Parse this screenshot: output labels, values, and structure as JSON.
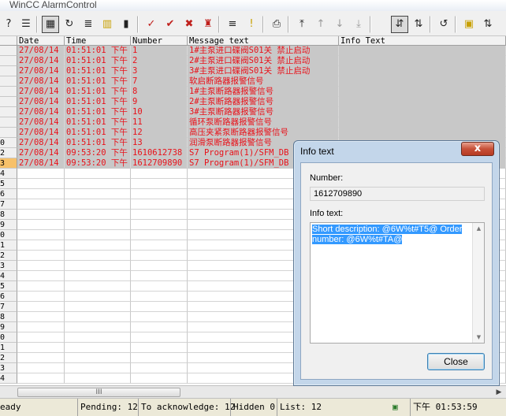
{
  "window": {
    "title": "WinCC AlarmControl"
  },
  "toolbar": {
    "buttons": [
      {
        "icon": "help-icon",
        "glyph": "?"
      },
      {
        "icon": "message-list-icon",
        "glyph": "☰"
      },
      {
        "icon": "table-view-icon",
        "glyph": "▦"
      },
      {
        "icon": "refresh-icon",
        "glyph": "↻"
      },
      {
        "icon": "hit-list-icon",
        "glyph": "≣"
      },
      {
        "icon": "archive-icon",
        "glyph": "▥"
      },
      {
        "icon": "statistics-icon",
        "glyph": "▮"
      },
      {
        "icon": "acknowledge-icon",
        "glyph": "✓"
      },
      {
        "icon": "group-acknowledge-icon",
        "glyph": "✔"
      },
      {
        "icon": "emergency-acknowledge-icon",
        "glyph": "✖"
      },
      {
        "icon": "horn-icon",
        "glyph": "♜"
      },
      {
        "icon": "selection-icon",
        "glyph": "≡"
      },
      {
        "icon": "info-text-icon",
        "glyph": "!"
      },
      {
        "icon": "print-icon",
        "glyph": "⎙"
      },
      {
        "icon": "first-icon",
        "glyph": "⤒"
      },
      {
        "icon": "previous-icon",
        "glyph": "↑"
      },
      {
        "icon": "next-icon",
        "glyph": "↓"
      },
      {
        "icon": "last-icon",
        "glyph": "⤓"
      },
      {
        "icon": "autoscroll-icon",
        "glyph": "⇵"
      },
      {
        "icon": "lock-icon",
        "glyph": "🔒"
      },
      {
        "icon": "sort-icon",
        "glyph": "⇅"
      }
    ]
  },
  "table": {
    "columns": [
      "Date",
      "Time",
      "Number",
      "Message text",
      "Info Text"
    ],
    "row_numbers": [
      "",
      "",
      "",
      "",
      "",
      "",
      "",
      "",
      "",
      "",
      "",
      "",
      "",
      "",
      "",
      "",
      "",
      "",
      "",
      "",
      "",
      "",
      "",
      "",
      "",
      "",
      "",
      "",
      "",
      "",
      "",
      "",
      "",
      ""
    ],
    "visible_row_numbers": [
      "1",
      "2",
      "3",
      "4",
      "5",
      "6",
      "7",
      "8",
      "9",
      "0",
      "1",
      "2",
      "3",
      "4",
      "5",
      "6",
      "7",
      "8",
      "9",
      "0",
      "1",
      "2",
      "3",
      "4",
      "5",
      "6",
      "7",
      "8",
      "9",
      "0",
      "1",
      "2",
      "3"
    ],
    "rows": [
      {
        "date": "27/08/14",
        "time": "01:51:01 下午",
        "number": "1",
        "message": "1#主泵进口碟阀S01关 禁止启动",
        "info": ""
      },
      {
        "date": "27/08/14",
        "time": "01:51:01 下午",
        "number": "2",
        "message": "2#主泵进口碟阀S01关 禁止启动",
        "info": ""
      },
      {
        "date": "27/08/14",
        "time": "01:51:01 下午",
        "number": "3",
        "message": "3#主泵进口碟阀S01关 禁止启动",
        "info": ""
      },
      {
        "date": "27/08/14",
        "time": "01:51:01 下午",
        "number": "7",
        "message": "软启断路器报警信号",
        "info": ""
      },
      {
        "date": "27/08/14",
        "time": "01:51:01 下午",
        "number": "8",
        "message": "1#主泵断路器报警信号",
        "info": ""
      },
      {
        "date": "27/08/14",
        "time": "01:51:01 下午",
        "number": "9",
        "message": "2#主泵断路器报警信号",
        "info": ""
      },
      {
        "date": "27/08/14",
        "time": "01:51:01 下午",
        "number": "10",
        "message": "3#主泵断路器报警信号",
        "info": ""
      },
      {
        "date": "27/08/14",
        "time": "01:51:01 下午",
        "number": "11",
        "message": "循环泵断路器报警信号",
        "info": ""
      },
      {
        "date": "27/08/14",
        "time": "01:51:01 下午",
        "number": "12",
        "message": "高压夹紧泵断路器报警信号",
        "info": ""
      },
      {
        "date": "27/08/14",
        "time": "01:51:01 下午",
        "number": "13",
        "message": "润滑泵断路器报警信号",
        "info": ""
      },
      {
        "date": "27/08/14",
        "time": "09:53:20 下午",
        "number": "1610612738",
        "message": "S7 Program(1)/SFM_DB",
        "info": ""
      },
      {
        "date": "27/08/14",
        "time": "09:53:20 下午",
        "number": "1612709890",
        "message": "S7 Program(1)/SFM_DB",
        "info": ""
      }
    ],
    "left_row_labels": [
      "",
      "",
      "",
      "",
      "",
      "",
      "",
      "",
      "",
      "",
      "0",
      "2",
      "3",
      "4",
      "5",
      "6",
      "7",
      "8",
      "9",
      "0",
      "1",
      "2",
      "3",
      "4",
      "5",
      "6",
      "7",
      "8",
      "9",
      "0",
      "1",
      "2",
      "3"
    ],
    "alarm_color": "#e8121a",
    "selected_row_color": "#f7c16a"
  },
  "hscroll": {
    "thumb_glyph": "III"
  },
  "status": {
    "ready": "eady",
    "pending": "Pending: 12",
    "to_ack": "To acknowledge: 12",
    "hidden": "Hidden 0",
    "list": "List: 12",
    "time": "下午 01:53:59"
  },
  "dialog": {
    "title": "Info text",
    "close_x": "x",
    "number_label": "Number:",
    "number_value": "1612709890",
    "info_label": "Info text:",
    "info_value": "Short description: @6W%t#T5@ Order number: @6W%t#TA@",
    "close_button": "Close"
  }
}
